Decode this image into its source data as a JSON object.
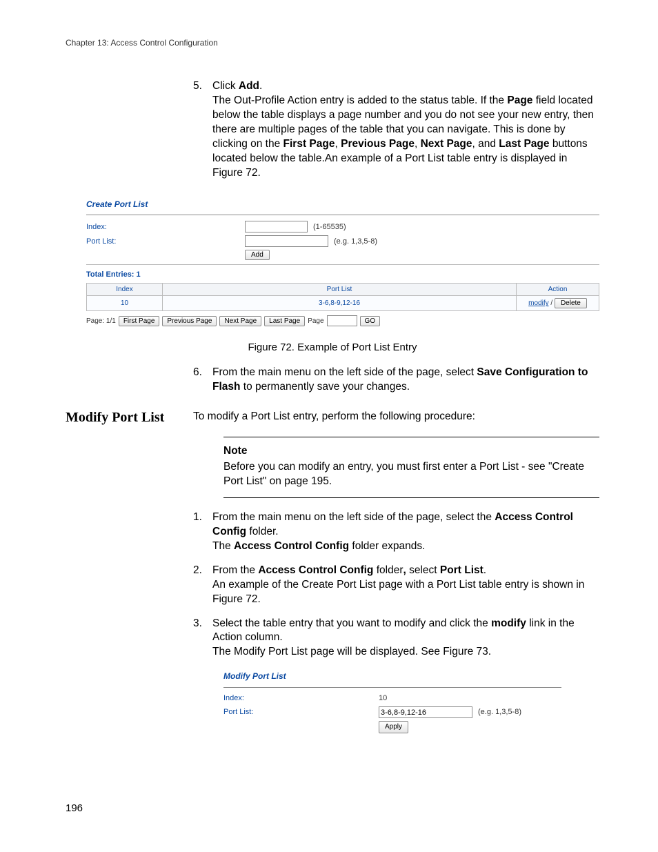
{
  "chapter_header": "Chapter 13: Access Control Configuration",
  "step5": {
    "num": "5.",
    "line1_pre": "Click ",
    "line1_b": "Add",
    "line1_post": ".",
    "body_1": "The Out-Profile Action entry is added to the status table. If the ",
    "body_b_page": "Page",
    "body_2": " field located below the table displays a page number and you do not see your new entry, then there are multiple pages of the table that you can navigate. This is done by clicking on the ",
    "body_b_first": "First Page",
    "body_3": ", ",
    "body_b_prev": "Previous Page",
    "body_4": ", ",
    "body_b_next": "Next Page",
    "body_5": ", and ",
    "body_b_last": "Last Page",
    "body_6": " buttons located below the table.An example of a Port List table entry is displayed in Figure 72."
  },
  "shot1": {
    "title": "Create Port List",
    "index_label": "Index:",
    "index_hint": "(1-65535)",
    "portlist_label": "Port List:",
    "portlist_hint": "(e.g. 1,3,5-8)",
    "add_btn": "Add",
    "total_entries_label": "Total Entries:",
    "total_entries_value": "1",
    "th_index": "Index",
    "th_portlist": "Port List",
    "th_action": "Action",
    "row_index": "10",
    "row_portlist": "3-6,8-9,12-16",
    "row_modify": "modify",
    "row_sep": " / ",
    "row_delete": "Delete",
    "page_label": "Page: 1/1",
    "btn_first": "First Page",
    "btn_prev": "Previous Page",
    "btn_next": "Next Page",
    "btn_last": "Last Page",
    "page_word": "Page",
    "btn_go": "GO"
  },
  "figure72_caption": "Figure 72. Example of Port List Entry",
  "step6": {
    "num": "6.",
    "pre": "From the main menu on the left side of the page, select ",
    "b1": "Save Configuration to Flash",
    "post": " to permanently save your changes."
  },
  "section_heading": "Modify Port List",
  "section_intro": "To modify a Port List entry, perform the following procedure:",
  "note": {
    "title": "Note",
    "body": "Before you can modify an entry, you must first enter a Port List - see \"Create Port List\" on page 195."
  },
  "m1": {
    "num": "1.",
    "pre": "From the main menu on the left side of the page, select the ",
    "b1": "Access Control Config",
    "mid": " folder.",
    "line2_pre": "The ",
    "line2_b": "Access Control Config",
    "line2_post": " folder expands."
  },
  "m2": {
    "num": "2.",
    "pre": "From the ",
    "b1": "Access Control Config",
    "mid1": " folder",
    "comma": ",",
    "mid2": " select ",
    "b2": "Port List",
    "post": ".",
    "line2": "An example of the Create Port List page with a Port List table entry is shown in Figure 72."
  },
  "m3": {
    "num": "3.",
    "pre": "Select the table entry that you want to modify and click the ",
    "b1": "modify",
    "post": " link in the Action column.",
    "line2": "The Modify Port List page will be displayed. See Figure 73."
  },
  "shot2": {
    "title": "Modify Port List",
    "index_label": "Index:",
    "index_value": "10",
    "portlist_label": "Port List:",
    "portlist_value": "3-6,8-9,12-16",
    "portlist_hint": "(e.g. 1,3,5-8)",
    "apply_btn": "Apply"
  },
  "page_number": "196"
}
